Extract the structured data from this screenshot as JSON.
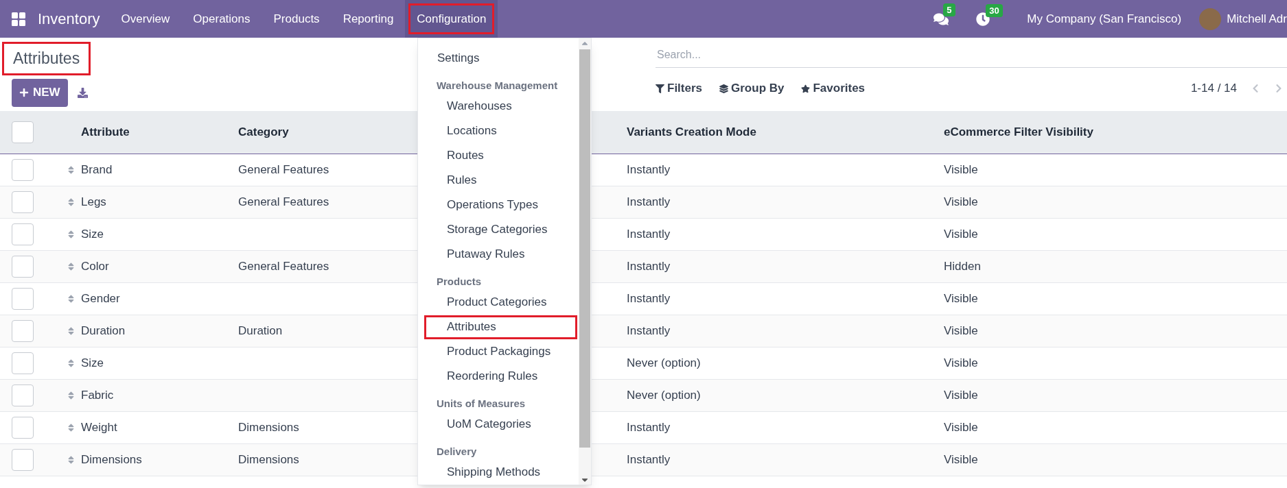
{
  "navbar": {
    "app": "Inventory",
    "menus": [
      {
        "label": "Overview",
        "selected": false,
        "highlighted": false
      },
      {
        "label": "Operations",
        "selected": false,
        "highlighted": false
      },
      {
        "label": "Products",
        "selected": false,
        "highlighted": false
      },
      {
        "label": "Reporting",
        "selected": false,
        "highlighted": false
      },
      {
        "label": "Configuration",
        "selected": true,
        "highlighted": true
      }
    ],
    "messages_count": "5",
    "activities_count": "30",
    "company": "My Company (San Francisco)",
    "user": "Mitchell Adr"
  },
  "page": {
    "title": "Attributes",
    "title_highlighted": true,
    "new_button": "NEW"
  },
  "search": {
    "placeholder": "Search..."
  },
  "filters": [
    "Filters",
    "Group By",
    "Favorites"
  ],
  "pager": "1-14 / 14",
  "table": {
    "select_all_checked": false,
    "columns": [
      "Attribute",
      "Category",
      "Variants Creation Mode",
      "eCommerce Filter Visibility"
    ],
    "rows": [
      {
        "checked": false,
        "attribute": "Brand",
        "category": "General Features",
        "mode": "Instantly",
        "visibility": "Visible"
      },
      {
        "checked": false,
        "attribute": "Legs",
        "category": "General Features",
        "mode": "Instantly",
        "visibility": "Visible"
      },
      {
        "checked": false,
        "attribute": "Size",
        "category": "",
        "mode": "Instantly",
        "visibility": "Visible"
      },
      {
        "checked": false,
        "attribute": "Color",
        "category": "General Features",
        "mode": "Instantly",
        "visibility": "Hidden"
      },
      {
        "checked": false,
        "attribute": "Gender",
        "category": "",
        "mode": "Instantly",
        "visibility": "Visible"
      },
      {
        "checked": false,
        "attribute": "Duration",
        "category": "Duration",
        "mode": "Instantly",
        "visibility": "Visible"
      },
      {
        "checked": false,
        "attribute": "Size",
        "category": "",
        "mode": "Never (option)",
        "visibility": "Visible"
      },
      {
        "checked": false,
        "attribute": "Fabric",
        "category": "",
        "mode": "Never (option)",
        "visibility": "Visible"
      },
      {
        "checked": false,
        "attribute": "Weight",
        "category": "Dimensions",
        "mode": "Instantly",
        "visibility": "Visible"
      },
      {
        "checked": false,
        "attribute": "Dimensions",
        "category": "Dimensions",
        "mode": "Instantly",
        "visibility": "Visible"
      }
    ]
  },
  "dropdown": {
    "items": [
      {
        "kind": "item",
        "label": "Settings",
        "highlighted": false
      },
      {
        "kind": "header",
        "label": "Warehouse Management"
      },
      {
        "kind": "subitem",
        "label": "Warehouses",
        "highlighted": false
      },
      {
        "kind": "subitem",
        "label": "Locations",
        "highlighted": false
      },
      {
        "kind": "subitem",
        "label": "Routes",
        "highlighted": false
      },
      {
        "kind": "subitem",
        "label": "Rules",
        "highlighted": false
      },
      {
        "kind": "subitem",
        "label": "Operations Types",
        "highlighted": false
      },
      {
        "kind": "subitem",
        "label": "Storage Categories",
        "highlighted": false
      },
      {
        "kind": "subitem",
        "label": "Putaway Rules",
        "highlighted": false
      },
      {
        "kind": "header",
        "label": "Products"
      },
      {
        "kind": "subitem",
        "label": "Product Categories",
        "highlighted": false
      },
      {
        "kind": "subitem",
        "label": "Attributes",
        "highlighted": true
      },
      {
        "kind": "subitem",
        "label": "Product Packagings",
        "highlighted": false
      },
      {
        "kind": "subitem",
        "label": "Reordering Rules",
        "highlighted": false
      },
      {
        "kind": "header",
        "label": "Units of Measures"
      },
      {
        "kind": "subitem",
        "label": "UoM Categories",
        "highlighted": false
      },
      {
        "kind": "header",
        "label": "Delivery"
      },
      {
        "kind": "subitem",
        "label": "Shipping Methods",
        "highlighted": false
      }
    ]
  }
}
